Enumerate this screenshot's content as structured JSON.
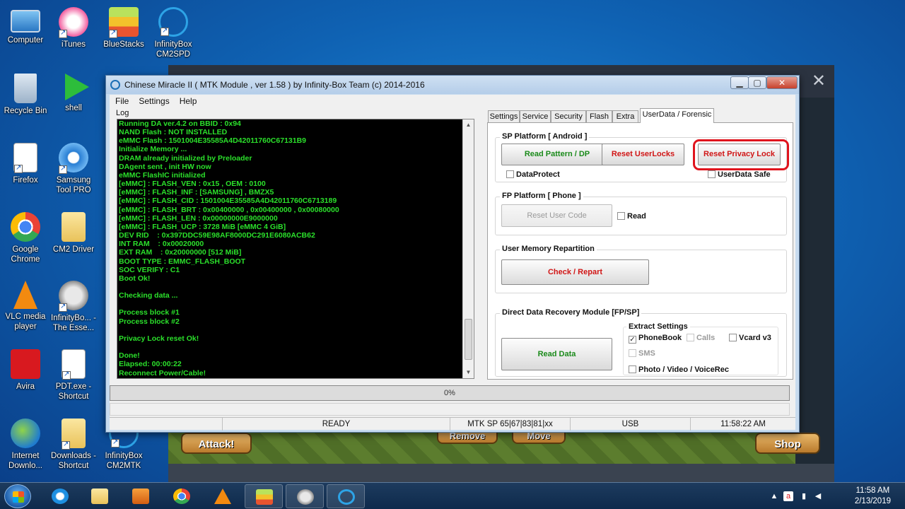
{
  "desktop": {
    "icons": [
      {
        "label": "Computer"
      },
      {
        "label": "iTunes"
      },
      {
        "label": "BlueStacks"
      },
      {
        "label": "InfinityBox CM2SPD"
      },
      {
        "label": "Recycle Bin"
      },
      {
        "label": "shell"
      },
      {
        "label": "Firefox"
      },
      {
        "label": "Samsung Tool PRO"
      },
      {
        "label": "Google Chrome"
      },
      {
        "label": "CM2 Driver"
      },
      {
        "label": "VLC media player"
      },
      {
        "label": "InfinityBo... - The Esse..."
      },
      {
        "label": "Avira"
      },
      {
        "label": "PDT.exe - Shortcut"
      },
      {
        "label": "Internet Downlo..."
      },
      {
        "label": "Downloads - Shortcut"
      },
      {
        "label": "InfinityBox CM2MTK"
      }
    ]
  },
  "background_app": {
    "buttons": {
      "attack": "Attack!",
      "remove": "Remove",
      "move": "Move",
      "shop": "Shop"
    }
  },
  "window": {
    "title": "Chinese Miracle II ( MTK Module , ver 1.58 ) by Infinity-Box Team (c) 2014-2016",
    "menu": [
      "File",
      "Settings",
      "Help"
    ],
    "log_label": "Log",
    "log_lines": [
      "Running DA ver.4.2 on BBID : 0x94",
      "NAND Flash : NOT INSTALLED",
      "eMMC Flash : 1501004E35585A4D42011760C67131B9",
      "Initialize Memory ...",
      "DRAM already initialized by Preloader",
      "DAgent sent , init HW now",
      "eMMC FlashIC initialized",
      "[eMMC] : FLASH_VEN : 0x15 , OEM : 0100",
      "[eMMC] : FLASH_INF : [SAMSUNG] , BMZX5",
      "[eMMC] : FLASH_CID : 1501004E35585A4D42011760C6713189",
      "[eMMC] : FLASH_BRT : 0x00400000 , 0x00400000 , 0x00080000",
      "[eMMC] : FLASH_LEN : 0x00000000E9000000",
      "[eMMC] : FLASH_UCP : 3728 MiB [eMMC 4 GiB]",
      "DEV RID    : 0x397DDC59E98AF8000DC291E6080ACB62",
      "INT RAM    : 0x00020000",
      "EXT RAM    : 0x20000000 [512 MiB]",
      "BOOT TYPE : EMMC_FLASH_BOOT",
      "SOC VERIFY : C1",
      "Boot Ok!",
      "",
      "Checking data ...",
      "",
      "Process block #1",
      "Process block #2",
      "",
      "Privacy Lock reset Ok!",
      "",
      "Done!",
      "Elapsed: 00:00:22",
      "Reconnect Power/Cable!"
    ],
    "tabs": [
      "Settings",
      "Service",
      "Security",
      "Flash",
      "Extra",
      "UserData / Forensic"
    ],
    "active_tab": "UserData / Forensic",
    "sp_platform": {
      "title": "SP Platform [ Android ]",
      "read_pattern": "Read Pattern / DP",
      "reset_userlocks": "Reset UserLocks",
      "reset_privacy": "Reset Privacy Lock",
      "dataprotect": "DataProtect",
      "userdata_safe": "UserData Safe"
    },
    "fp_platform": {
      "title": "FP Platform [ Phone ]",
      "reset_user_code": "Reset User Code",
      "read": "Read"
    },
    "repartition": {
      "title": "User Memory Repartition",
      "check_repart": "Check / Repart"
    },
    "recovery": {
      "title": "Direct Data Recovery Module  [FP/SP]",
      "read_data": "Read Data",
      "extract_title": "Extract Settings",
      "phonebook": "PhoneBook",
      "calls": "Calls",
      "vcard": "Vcard v3",
      "sms": "SMS",
      "photo": "Photo / Video / VoiceRec"
    },
    "progress": {
      "text": "0%",
      "value": 0
    },
    "status": {
      "state": "READY",
      "platform": "MTK SP 65|67|83|81|xx",
      "port": "USB",
      "time": "11:58:22 AM"
    }
  },
  "taskbar": {
    "time": "11:58 AM",
    "date": "2/13/2019"
  },
  "colors": {
    "log_text": "#2be02b",
    "green_button": "#1a8a1a",
    "red_button": "#d01515",
    "highlight": "#e0141d",
    "desktop_blue": "#0f62b3"
  }
}
